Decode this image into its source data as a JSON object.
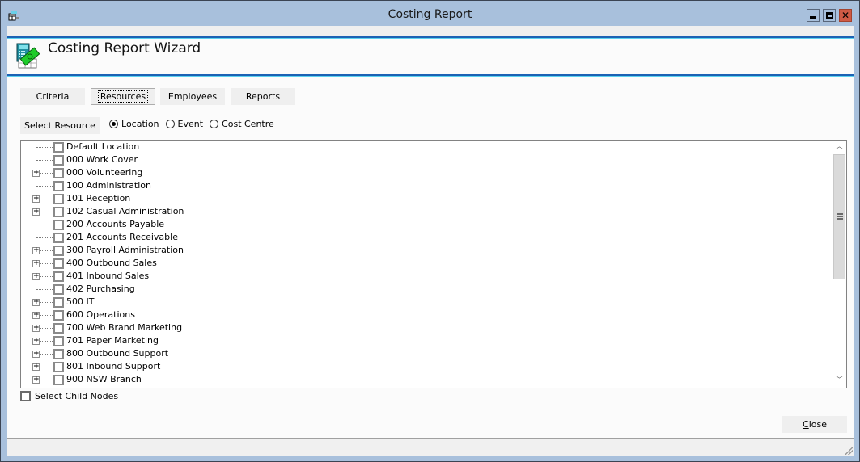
{
  "window": {
    "title": "Costing Report",
    "controls": {
      "minimize": "minimize",
      "maximize": "maximize",
      "close": "close"
    }
  },
  "header": {
    "title": "Costing Report Wizard",
    "icon": "calculator-money-icon"
  },
  "tabs": [
    {
      "label": "Criteria",
      "selected": false
    },
    {
      "label": "Resources",
      "selected": true,
      "focused": true
    },
    {
      "label": "Employees",
      "selected": false
    },
    {
      "label": "Reports",
      "selected": false
    }
  ],
  "resource_selector": {
    "button_label": "Select Resource",
    "options": [
      {
        "label_prefix": "",
        "mnemonic": "L",
        "label_rest": "ocation",
        "checked": true
      },
      {
        "label_prefix": "",
        "mnemonic": "E",
        "label_rest": "vent",
        "checked": false
      },
      {
        "label_prefix": "",
        "mnemonic": "C",
        "label_rest": "ost Centre",
        "checked": false
      }
    ]
  },
  "tree": {
    "nodes": [
      {
        "label": "Default Location",
        "expandable": false,
        "checked": false
      },
      {
        "label": "000 Work Cover",
        "expandable": false,
        "checked": false
      },
      {
        "label": "000 Volunteering",
        "expandable": true,
        "checked": false
      },
      {
        "label": "100 Administration",
        "expandable": false,
        "checked": false
      },
      {
        "label": "101 Reception",
        "expandable": true,
        "checked": false
      },
      {
        "label": "102 Casual Administration",
        "expandable": true,
        "checked": false
      },
      {
        "label": "200 Accounts Payable",
        "expandable": false,
        "checked": false
      },
      {
        "label": "201 Accounts Receivable",
        "expandable": false,
        "checked": false
      },
      {
        "label": "300 Payroll Administration",
        "expandable": true,
        "checked": false
      },
      {
        "label": "400 Outbound Sales",
        "expandable": true,
        "checked": false
      },
      {
        "label": "401 Inbound Sales",
        "expandable": true,
        "checked": false
      },
      {
        "label": "402 Purchasing",
        "expandable": false,
        "checked": false
      },
      {
        "label": "500 IT",
        "expandable": true,
        "checked": false
      },
      {
        "label": "600 Operations",
        "expandable": true,
        "checked": false
      },
      {
        "label": "700 Web Brand Marketing",
        "expandable": true,
        "checked": false
      },
      {
        "label": "701 Paper Marketing",
        "expandable": true,
        "checked": false
      },
      {
        "label": "800 Outbound Support",
        "expandable": true,
        "checked": false
      },
      {
        "label": "801 Inbound Support",
        "expandable": true,
        "checked": false
      },
      {
        "label": "900 NSW Branch",
        "expandable": true,
        "checked": false
      }
    ],
    "expander_glyph": "+"
  },
  "select_child_nodes": {
    "label": "Select Child Nodes",
    "checked": false
  },
  "footer": {
    "close_mnemonic": "C",
    "close_rest": "lose"
  },
  "colors": {
    "titlebar": "#a8c0dc",
    "accent_line": "#1c62b4",
    "accent_line_light": "#5cd1f0",
    "close_button": "#cf5a45"
  }
}
